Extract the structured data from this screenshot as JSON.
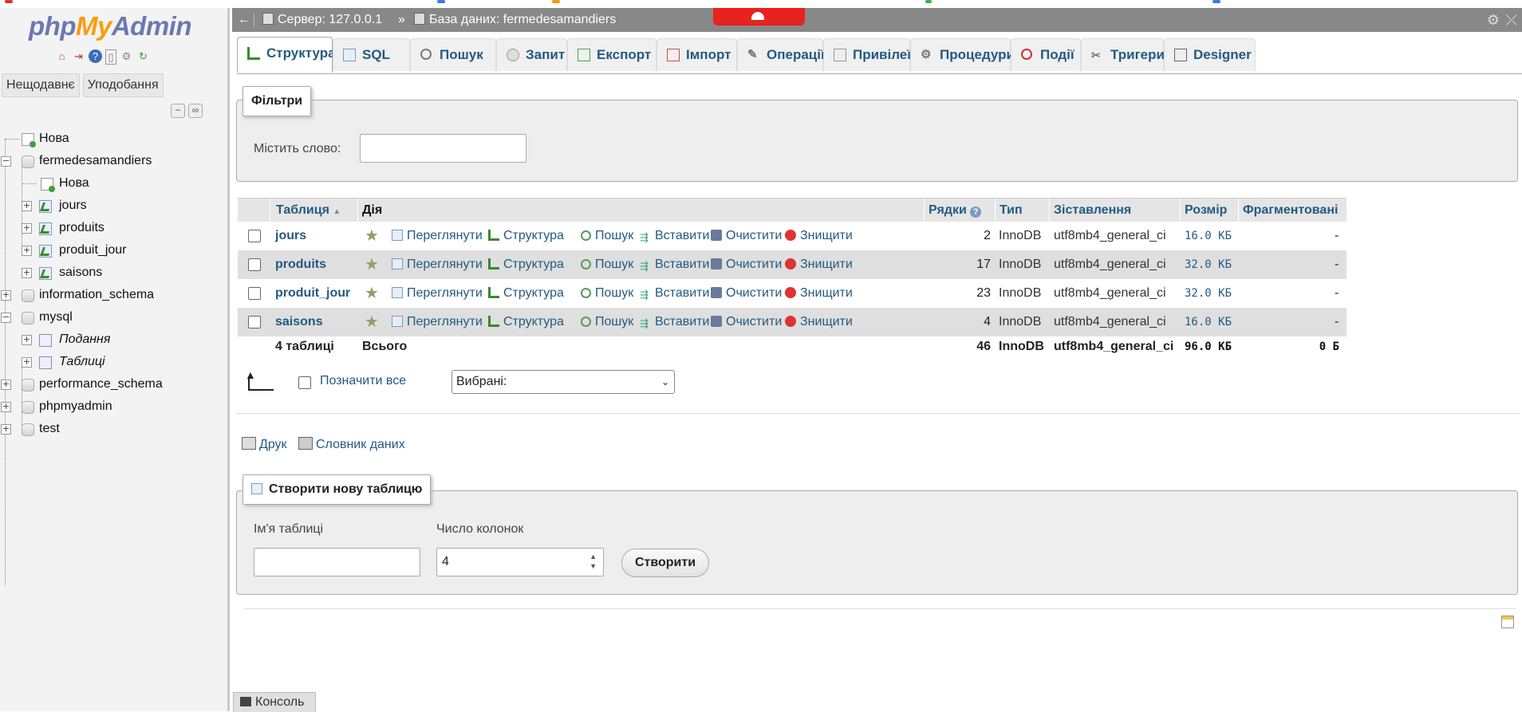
{
  "logo": {
    "part1": "php",
    "part2": "My",
    "part3": "Admin"
  },
  "nav": {
    "recent_label": "Нещодавнє",
    "favorites_label": "Уподобання",
    "tree": [
      {
        "label": "Нова"
      },
      {
        "label": "fermedesamandiers"
      },
      {
        "label": "Нова"
      },
      {
        "label": "jours"
      },
      {
        "label": "produits"
      },
      {
        "label": "produit_jour"
      },
      {
        "label": "saisons"
      },
      {
        "label": "information_schema"
      },
      {
        "label": "mysql"
      },
      {
        "label": "Подання"
      },
      {
        "label": "Таблиці"
      },
      {
        "label": "performance_schema"
      },
      {
        "label": "phpmyadmin"
      },
      {
        "label": "test"
      }
    ]
  },
  "breadcrumb": {
    "back": "←",
    "server": "Сервер: 127.0.0.1",
    "separator": "»",
    "database": "База даних: fermedesamandiers"
  },
  "tabs": [
    {
      "label": "Структура",
      "icon": "structure-icon",
      "active": true
    },
    {
      "label": "SQL",
      "icon": "sql-icon"
    },
    {
      "label": "Пошук",
      "icon": "search-icon"
    },
    {
      "label": "Запит",
      "icon": "query-icon"
    },
    {
      "label": "Експорт",
      "icon": "export-icon"
    },
    {
      "label": "Імпорт",
      "icon": "import-icon"
    },
    {
      "label": "Операції",
      "icon": "wrench-icon"
    },
    {
      "label": "Привілеї",
      "icon": "privileges-icon"
    },
    {
      "label": "Процедури",
      "icon": "routines-icon"
    },
    {
      "label": "Події",
      "icon": "events-icon"
    },
    {
      "label": "Тригери",
      "icon": "triggers-icon"
    },
    {
      "label": "Designer",
      "icon": "designer-icon"
    }
  ],
  "filters": {
    "legend": "Фільтри",
    "label": "Містить слово:",
    "value": ""
  },
  "table": {
    "headers": {
      "table": "Таблиця",
      "sort_mark": "▲",
      "action": "Дія",
      "rows": "Рядки",
      "type": "Тип",
      "collation": "Зіставлення",
      "size": "Розмір",
      "overhead": "Фрагментовані"
    },
    "actions": {
      "browse": "Переглянути",
      "structure": "Структура",
      "search": "Пошук",
      "insert": "Вставити",
      "empty": "Очистити",
      "drop": "Знищити"
    },
    "rows": [
      {
        "name": "jours",
        "rows": "2",
        "type": "InnoDB",
        "collation": "utf8mb4_general_ci",
        "size": "16.0 КБ",
        "overhead": "-"
      },
      {
        "name": "produits",
        "rows": "17",
        "type": "InnoDB",
        "collation": "utf8mb4_general_ci",
        "size": "32.0 КБ",
        "overhead": "-"
      },
      {
        "name": "produit_jour",
        "rows": "23",
        "type": "InnoDB",
        "collation": "utf8mb4_general_ci",
        "size": "32.0 КБ",
        "overhead": "-"
      },
      {
        "name": "saisons",
        "rows": "4",
        "type": "InnoDB",
        "collation": "utf8mb4_general_ci",
        "size": "16.0 КБ",
        "overhead": "-"
      }
    ],
    "total": {
      "count": "4 таблиці",
      "label": "Всього",
      "rows": "46",
      "type": "InnoDB",
      "collation": "utf8mb4_general_ci",
      "size": "96.0 КБ",
      "overhead": "0 Б"
    }
  },
  "bulk": {
    "check_all": "Позначити все",
    "with_selected": "Вибрані:"
  },
  "links": {
    "print": "Друк",
    "dictionary": "Словник даних"
  },
  "create": {
    "legend": "Створити нову таблицю",
    "name_label": "Ім'я таблиці",
    "name_value": "",
    "cols_label": "Число колонок",
    "cols_value": "4",
    "button": "Створити"
  },
  "console": {
    "label": "Консоль"
  },
  "colors": {
    "link": "#235a81",
    "breadcrumb_bg": "#888888",
    "row_alt": "#dfdfdf"
  }
}
